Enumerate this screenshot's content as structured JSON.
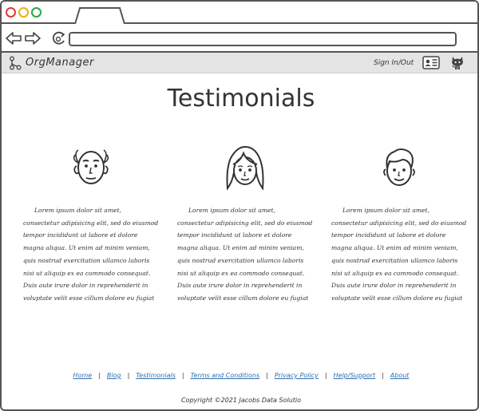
{
  "browser": {
    "url": ""
  },
  "nav": {
    "brand": "OrgManager",
    "signin": "Sign In/Out"
  },
  "main": {
    "title": "Testimonials",
    "testimonials": [
      {
        "avatar": "bald-man-face",
        "text": "Lorem ipsum dolor sit amet, consectetur adipisicing elit, sed do eiusmod tempor incididunt ut labore et dolore magna aliqua. Ut enim ad minim veniam, quis nostrud exercitation ullamco laboris nisi ut aliquip ex ea commodo consequat. Duis aute irure dolor in reprehenderit in voluptate velit esse cillum dolore eu fugiat nulla pariatur. Excepteur sint occaecat cupidatat non proident, sunt in culpa qui officia deserunt mollit anim id est laborum."
      },
      {
        "avatar": "woman-face",
        "text": "Lorem ipsum dolor sit amet, consectetur adipisicing elit, sed do eiusmod tempor incididunt ut labore et dolore magna aliqua. Ut enim ad minim veniam, quis nostrud exercitation ullamco laboris nisi ut aliquip ex ea commodo consequat. Duis aute irure dolor in reprehenderit in voluptate velit esse cillum dolore eu fugiat nulla pariatur. Excepteur sint occaecat cupidatat non proident, sunt in culpa qui officia deserunt mollit anim id est laborum."
      },
      {
        "avatar": "young-man-face",
        "text": "Lorem ipsum dolor sit amet, consectetur adipisicing elit, sed do eiusmod tempor incididunt ut labore et dolore magna aliqua. Ut enim ad minim veniam, quis nostrud exercitation ullamco laboris nisi ut aliquip ex ea commodo consequat. Duis aute irure dolor in reprehenderit in voluptate velit esse cillum dolore eu fugiat nulla pariatur. Excepteur sint occaecat cupidatat non proident, sunt in culpa qui officia deserunt mollit anim id est laborum."
      }
    ]
  },
  "footer": {
    "links": [
      "Home",
      "Blog",
      "Testimonials",
      "Terms and Conditions",
      "Privacy Policy",
      "Help/Support",
      "About"
    ],
    "copyright": "Copyright ©2021 Jacobs Data Solutio"
  },
  "colors": {
    "link": "#2f6fb0",
    "nav_bg": "#e4e4e4",
    "close_dot": "#e03c31",
    "minimize_dot": "#e6b30a",
    "maximize_dot": "#28a745"
  }
}
